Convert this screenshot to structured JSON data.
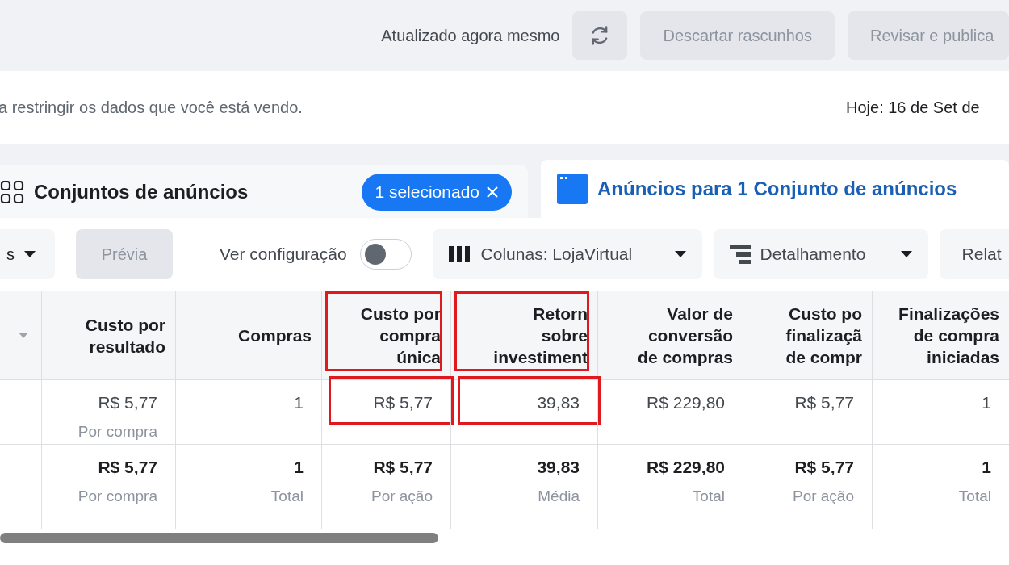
{
  "top_bar": {
    "status": "Atualizado agora mesmo",
    "buttons": [
      {
        "label": "Descartar rascunhos",
        "disabled": true
      },
      {
        "label": "Revisar e publica",
        "disabled": true
      }
    ]
  },
  "filter_bar": {
    "hint": "a restringir os dados que você está vendo.",
    "date": "Hoje: 16 de Set de"
  },
  "tabs": [
    {
      "label": "Conjuntos de anúncios",
      "selected": false,
      "badge": "1 selecionado"
    },
    {
      "label": "Anúncios para 1 Conjunto de anúncios",
      "selected": true
    }
  ],
  "toolbar": {
    "cut_dropdown": "s",
    "preview": {
      "label": "Prévia",
      "disabled": true
    },
    "toggle": {
      "label": "Ver configuração",
      "on": false
    },
    "columns": "Colunas: LojaVirtual",
    "breakdown": "Detalhamento",
    "reports": "Relat"
  },
  "table": {
    "columns": [
      {
        "lines": [
          "Custo por",
          "resultado"
        ],
        "annotated": false
      },
      {
        "lines": [
          "Compras"
        ],
        "annotated": false
      },
      {
        "lines": [
          "Custo por",
          "compra",
          "única"
        ],
        "annotated": true
      },
      {
        "lines": [
          "Retorn",
          "sobre",
          "investiment"
        ],
        "annotated": true
      },
      {
        "lines": [
          "Valor de",
          "conversão",
          "de compras"
        ],
        "annotated": false
      },
      {
        "lines": [
          "Custo po",
          "finalizaçã",
          "de compr"
        ],
        "annotated": false
      },
      {
        "lines": [
          "Finalizações",
          "de compra",
          "iniciadas"
        ],
        "annotated": false
      }
    ],
    "rows": [
      {
        "kind": "data",
        "cells": [
          {
            "value": "R$ 5,77",
            "sub": "Por compra",
            "annotated": false
          },
          {
            "value": "1",
            "annotated": false
          },
          {
            "value": "R$ 5,77",
            "annotated": true
          },
          {
            "value": "39,83",
            "annotated": true
          },
          {
            "value": "R$ 229,80",
            "annotated": false
          },
          {
            "value": "R$ 5,77",
            "annotated": false
          },
          {
            "value": "1",
            "annotated": false
          }
        ]
      },
      {
        "kind": "total",
        "cells": [
          {
            "value": "R$ 5,77",
            "sub": "Por compra",
            "annotated": false
          },
          {
            "value": "1",
            "sub": "Total",
            "annotated": false
          },
          {
            "value": "R$ 5,77",
            "sub": "Por ação",
            "annotated": false
          },
          {
            "value": "39,83",
            "sub": "Média",
            "annotated": false
          },
          {
            "value": "R$ 229,80",
            "sub": "Total",
            "annotated": false
          },
          {
            "value": "R$ 5,77",
            "sub": "Por ação",
            "annotated": false
          },
          {
            "value": "1",
            "sub": "Total",
            "annotated": false
          }
        ]
      }
    ]
  }
}
